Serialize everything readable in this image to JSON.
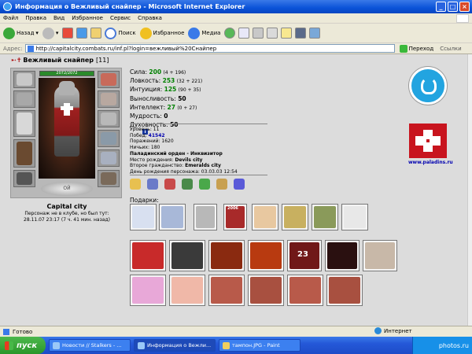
{
  "window": {
    "title": "Информация о Вежливый снайпер - Microsoft Internet Explorer"
  },
  "menu": [
    "Файл",
    "Правка",
    "Вид",
    "Избранное",
    "Сервис",
    "Справка"
  ],
  "toolbar": {
    "back": "Назад",
    "search": "Поиск",
    "favorites": "Избранное",
    "media": "Медиа"
  },
  "address": {
    "label": "Адрес:",
    "url": "http://capitalcity.combats.ru/inf.pl?login=вежливый%20Снайпер",
    "go": "Переход",
    "links": "Ссылки"
  },
  "character": {
    "name": "Вежливый снайпер",
    "level": "[11]",
    "hp": "2072/2072",
    "city": "Capital city",
    "status_line1": "Персонаж не в клубе, но был тут:",
    "status_line2": "28.11.07 23:17 (7 ч. 41 мин. назад)",
    "emblem": "ОЙ"
  },
  "stats": [
    {
      "label": "Сила:",
      "value": "200",
      "bonus": "(4 + 196)"
    },
    {
      "label": "Ловкость:",
      "value": "253",
      "bonus": "(32 + 221)"
    },
    {
      "label": "Интуиция:",
      "value": "125",
      "bonus": "(90 + 35)"
    },
    {
      "label": "Выносливость:",
      "value": "50",
      "bonus": ""
    },
    {
      "label": "Интеллект:",
      "value": "27",
      "bonus": "(0 + 27)"
    },
    {
      "label": "Мудрость:",
      "value": "0",
      "bonus": ""
    },
    {
      "label": "Духовность:",
      "value": "50",
      "bonus": ""
    }
  ],
  "info": {
    "level": "Уровень: 11",
    "wins_label": "Побед:",
    "wins": "41542",
    "losses": "Поражений: 1620",
    "draws": "Ничьих: 180",
    "order": "Паладинский орден - Инквизитор",
    "birthplace_label": "Место рождения:",
    "birthplace": "Devils city",
    "citizenship_label": "Второе гражданство:",
    "citizenship": "Emeralds city",
    "birthday": "День рождения персонажа: 03.03.03 12:54"
  },
  "gifts": {
    "label": "Подарки:",
    "year_badge": "2006",
    "card_number": "23"
  },
  "site_logo": "www.paladins.ru",
  "statusbar": {
    "left": "Готово",
    "zone": "Интернет"
  },
  "taskbar": {
    "start": "пуск",
    "tasks": [
      "Новости // Stalkers - ...",
      "Информация о Вежли...",
      "тампон.JPG - Paint"
    ],
    "watermark": "photos.ru"
  },
  "colors": {
    "stat_value": "#008000",
    "link_blue": "#0000b0",
    "xp_blue": "#0a52d8",
    "paladin_red": "#c8141e"
  }
}
